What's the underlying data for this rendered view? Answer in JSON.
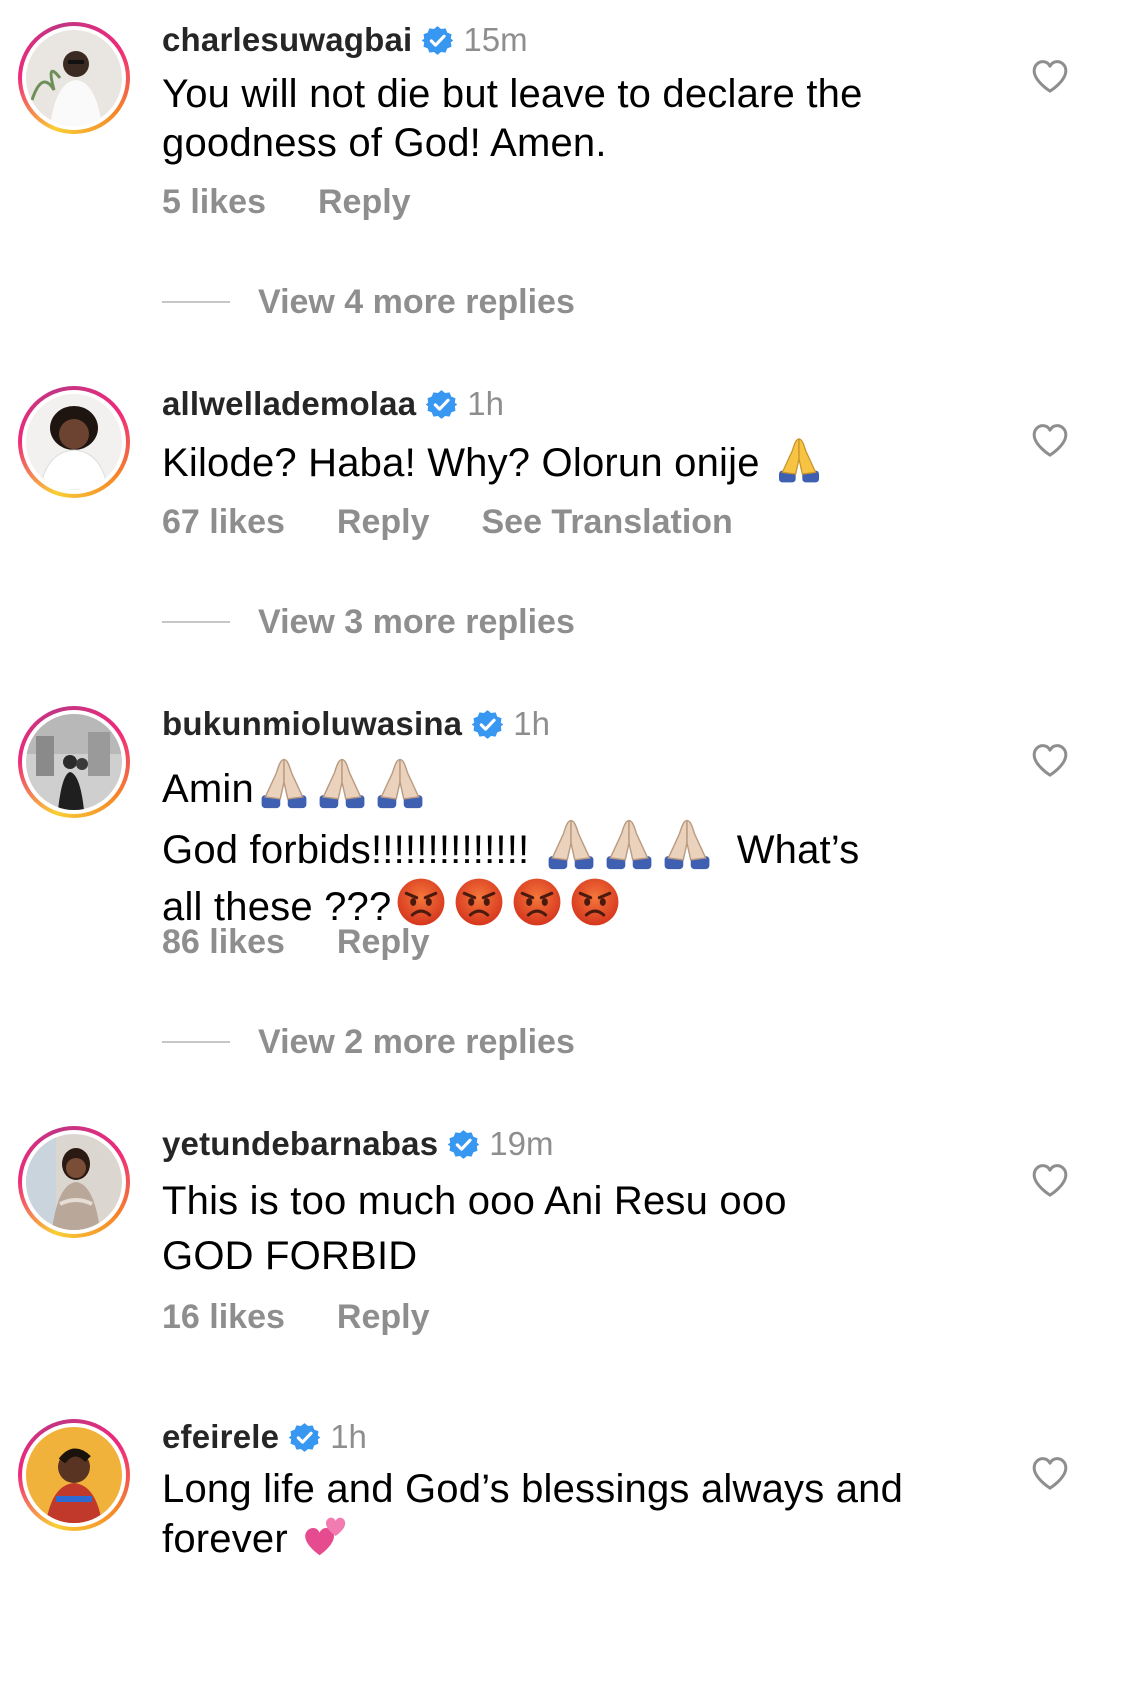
{
  "comments": [
    {
      "username": "charlesuwagbai",
      "time": "15m",
      "lines": [
        "You will not die but leave to declare the",
        "goodness of God! Amen."
      ],
      "likes": "5 likes",
      "reply": "Reply",
      "view_replies": "View 4 more replies"
    },
    {
      "username": "allwellademolaa",
      "time": "1h",
      "lines": [
        "Kilode? Haba! Why? Olorun onije"
      ],
      "likes": "67 likes",
      "reply": "Reply",
      "translate": "See Translation",
      "view_replies": "View 3 more replies"
    },
    {
      "username": "bukunmioluwasina",
      "time": "1h",
      "lines": [
        "Amin",
        "God forbids!!!!!!!!!!!!!!",
        "What’s",
        "all these ???"
      ],
      "likes": "86 likes",
      "reply": "Reply",
      "view_replies": "View 2 more replies"
    },
    {
      "username": "yetundebarnabas",
      "time": "19m",
      "lines": [
        "This is too much ooo Ani Resu ooo",
        "GOD FORBID"
      ],
      "likes": "16 likes",
      "reply": "Reply"
    },
    {
      "username": "efeirele",
      "time": "1h",
      "lines": [
        "Long life and God’s blessings always and",
        "forever"
      ]
    }
  ],
  "icons": {
    "verified": "verified-badge-icon",
    "like": "heart-outline-icon",
    "pray": "folded-hands-emoji",
    "angry": "angry-face-emoji",
    "hearts": "two-hearts-emoji"
  },
  "colors": {
    "username": "#262626",
    "meta": "#8e8e8e",
    "verified": "#3897f0",
    "divider": "#c7c7c7"
  }
}
